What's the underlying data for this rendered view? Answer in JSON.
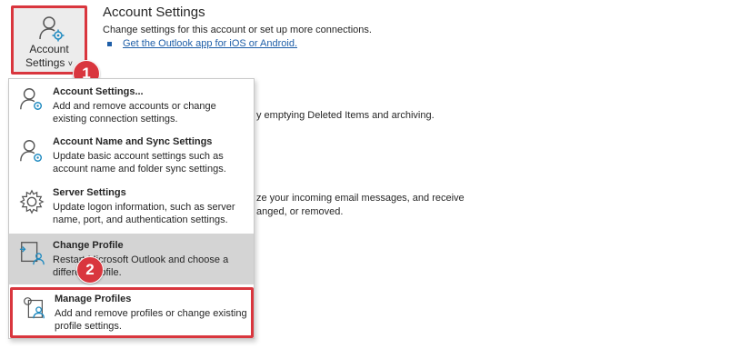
{
  "account_settings_button": {
    "line1": "Account",
    "line2": "Settings",
    "chevron": "˅",
    "icon": "person-gear-icon"
  },
  "header": {
    "title": "Account Settings",
    "description": "Change settings for this account or set up more connections.",
    "link": "Get the Outlook app for iOS or Android."
  },
  "background_text": {
    "line1": "y emptying Deleted Items and archiving.",
    "line2": "ze your incoming email messages, and receive",
    "line3": "anged, or removed."
  },
  "annotations": {
    "badge1": "1",
    "badge2": "2",
    "badge_color": "#d9363e"
  },
  "menu": {
    "items": [
      {
        "title": "Account Settings...",
        "desc": "Add and remove accounts or change existing connection settings.",
        "icon": "person-gear-icon"
      },
      {
        "title": "Account Name and Sync Settings",
        "desc": "Update basic account settings such as account name and folder sync settings.",
        "icon": "person-gear-icon"
      },
      {
        "title": "Server Settings",
        "desc": "Update logon information, such as server name, port, and authentication settings.",
        "icon": "gear-icon"
      },
      {
        "title": "Change Profile",
        "desc": "Restart Microsoft Outlook and choose a different profile.",
        "icon": "profile-switch-icon"
      },
      {
        "title": "Manage Profiles",
        "desc": "Add and remove profiles or change existing profile settings.",
        "icon": "manage-profiles-icon"
      }
    ]
  },
  "colors": {
    "accent_red": "#d9363e",
    "link_blue": "#1f5fa8",
    "highlight": "#d4d4d4"
  }
}
